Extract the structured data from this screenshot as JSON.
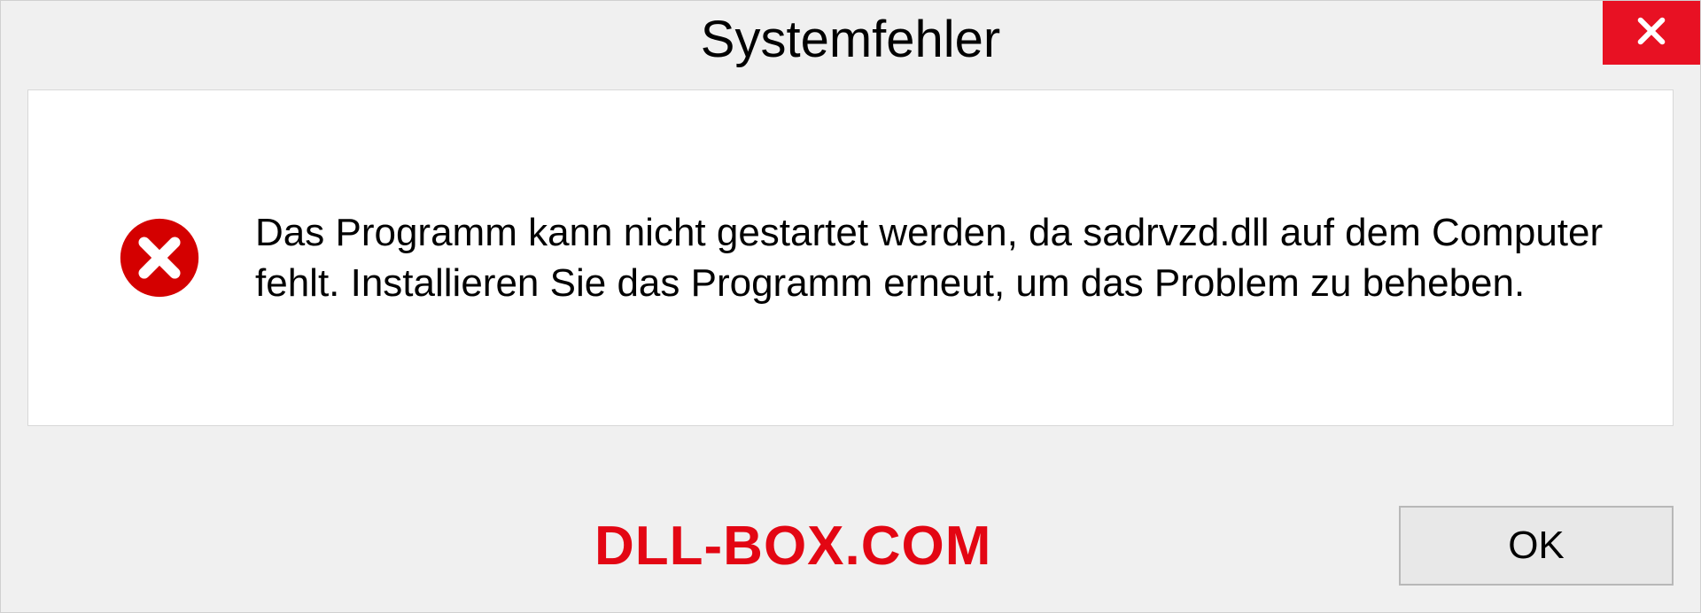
{
  "dialog": {
    "title": "Systemfehler",
    "message": "Das Programm kann nicht gestartet werden, da sadrvzd.dll auf dem Computer fehlt. Installieren Sie das Programm erneut, um das Problem zu beheben.",
    "ok_label": "OK"
  },
  "watermark": "DLL-BOX.COM"
}
